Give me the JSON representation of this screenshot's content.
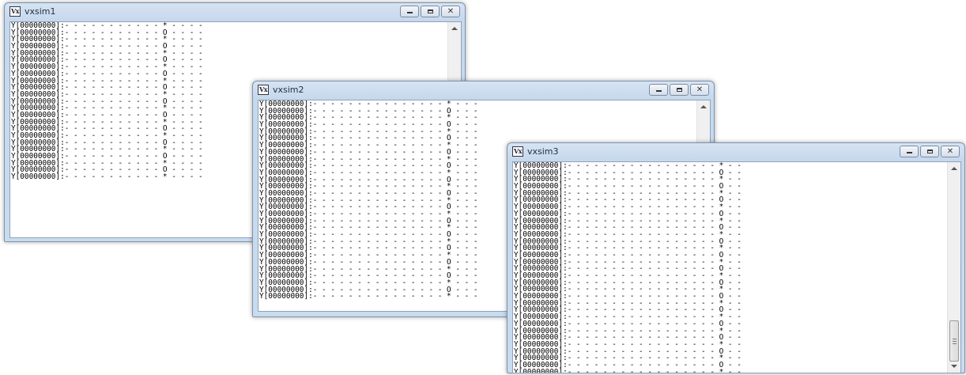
{
  "windows": [
    {
      "title": "vxsim1",
      "icon_label": "Vx",
      "lines": [
        "Y[00000000]:- - - - - - - - - - - * - - - -",
        "Y[00000000]:- - - - - - - - - - - O - - - -",
        "Y[00000000]:- - - - - - - - - - - * - - - -",
        "Y[00000000]:- - - - - - - - - - - O - - - -",
        "Y[00000000]:- - - - - - - - - - - * - - - -",
        "Y[00000000]:- - - - - - - - - - - O - - - -",
        "Y[00000000]:- - - - - - - - - - - * - - - -",
        "Y[00000000]:- - - - - - - - - - - O - - - -",
        "Y[00000000]:- - - - - - - - - - - * - - - -",
        "Y[00000000]:- - - - - - - - - - - O - - - -",
        "Y[00000000]:- - - - - - - - - - - * - - - -",
        "Y[00000000]:- - - - - - - - - - - O - - - -",
        "Y[00000000]:- - - - - - - - - - - * - - - -",
        "Y[00000000]:- - - - - - - - - - - O - - - -",
        "Y[00000000]:- - - - - - - - - - - * - - - -",
        "Y[00000000]:- - - - - - - - - - - O - - - -",
        "Y[00000000]:- - - - - - - - - - - * - - - -",
        "Y[00000000]:- - - - - - - - - - - O - - - -",
        "Y[00000000]:- - - - - - - - - - - * - - - -",
        "Y[00000000]:- - - - - - - - - - - O - - - -",
        "Y[00000000]:- - - - - - - - - - - * - - - -",
        "Y[00000000]:- - - - - - - - - - - O - - - -",
        "Y[00000000]:- - - - - - - - - - - * - - - -"
      ]
    },
    {
      "title": "vxsim2",
      "icon_label": "Vx",
      "lines": [
        "Y[00000000]:- - - - - - - - - - - - - - - * - - -",
        "Y[00000000]:- - - - - - - - - - - - - - - O - - -",
        "Y[00000000]:- - - - - - - - - - - - - - - * - - -",
        "Y[00000000]:- - - - - - - - - - - - - - - O - - -",
        "Y[00000000]:- - - - - - - - - - - - - - - * - - -",
        "Y[00000000]:- - - - - - - - - - - - - - - O - - -",
        "Y[00000000]:- - - - - - - - - - - - - - - * - - -",
        "Y[00000000]:- - - - - - - - - - - - - - - O - - -",
        "Y[00000000]:- - - - - - - - - - - - - - - * - - -",
        "Y[00000000]:- - - - - - - - - - - - - - - O - - -",
        "Y[00000000]:- - - - - - - - - - - - - - - * - - -",
        "Y[00000000]:- - - - - - - - - - - - - - - O - - -",
        "Y[00000000]:- - - - - - - - - - - - - - - * - - -",
        "Y[00000000]:- - - - - - - - - - - - - - - O - - -",
        "Y[00000000]:- - - - - - - - - - - - - - - * - - -",
        "Y[00000000]:- - - - - - - - - - - - - - - O - - -",
        "Y[00000000]:- - - - - - - - - - - - - - - * - - -",
        "Y[00000000]:- - - - - - - - - - - - - - - O - - -",
        "Y[00000000]:- - - - - - - - - - - - - - - * - - -",
        "Y[00000000]:- - - - - - - - - - - - - - - O - - -",
        "Y[00000000]:- - - - - - - - - - - - - - - * - - -",
        "Y[00000000]:- - - - - - - - - - - - - - - O - - -",
        "Y[00000000]:- - - - - - - - - - - - - - - * - - -",
        "Y[00000000]:- - - - - - - - - - - - - - - O - - -",
        "Y[00000000]:- - - - - - - - - - - - - - - * - - -",
        "Y[00000000]:- - - - - - - - - - - - - - - O - - -",
        "Y[00000000]:- - - - - - - - - - - - - - - * - - -",
        "Y[00000000]:- - - - - - - - - - - - - - - O - - -",
        "Y[00000000]:- - - - - - - - - - - - - - - * - - -"
      ]
    },
    {
      "title": "vxsim3",
      "icon_label": "Vx",
      "lines": [
        "Y[00000000]:- - - - - - - - - - - - - - - - - * - -",
        "Y[00000000]:- - - - - - - - - - - - - - - - - O - -",
        "Y[00000000]:- - - - - - - - - - - - - - - - - * - -",
        "Y[00000000]:- - - - - - - - - - - - - - - - - O - -",
        "Y[00000000]:- - - - - - - - - - - - - - - - - * - -",
        "Y[00000000]:- - - - - - - - - - - - - - - - - O - -",
        "Y[00000000]:- - - - - - - - - - - - - - - - - * - -",
        "Y[00000000]:- - - - - - - - - - - - - - - - - O - -",
        "Y[00000000]:- - - - - - - - - - - - - - - - - * - -",
        "Y[00000000]:- - - - - - - - - - - - - - - - - O - -",
        "Y[00000000]:- - - - - - - - - - - - - - - - - * - -",
        "Y[00000000]:- - - - - - - - - - - - - - - - - O - -",
        "Y[00000000]:- - - - - - - - - - - - - - - - - * - -",
        "Y[00000000]:- - - - - - - - - - - - - - - - - O - -",
        "Y[00000000]:- - - - - - - - - - - - - - - - - * - -",
        "Y[00000000]:- - - - - - - - - - - - - - - - - O - -",
        "Y[00000000]:- - - - - - - - - - - - - - - - - * - -",
        "Y[00000000]:- - - - - - - - - - - - - - - - - O - -",
        "Y[00000000]:- - - - - - - - - - - - - - - - - * - -",
        "Y[00000000]:- - - - - - - - - - - - - - - - - O - -",
        "Y[00000000]:- - - - - - - - - - - - - - - - - * - -",
        "Y[00000000]:- - - - - - - - - - - - - - - - - O - -",
        "Y[00000000]:- - - - - - - - - - - - - - - - - * - -",
        "Y[00000000]:- - - - - - - - - - - - - - - - - O - -",
        "Y[00000000]:- - - - - - - - - - - - - - - - - * - -",
        "Y[00000000]:- - - - - - - - - - - - - - - - - O - -",
        "Y[00000000]:- - - - - - - - - - - - - - - - - * - -",
        "Y[00000000]:- - - - - - - - - - - - - - - - - O - -",
        "Y[00000000]:- - - - - - - - - - - - - - - - - * - -",
        "Y[00000000]:- - - - - - - - - - - - - - - - - O - -",
        "Y[00000000]:- - - - - - - - - - - - - - - - - * - -"
      ]
    }
  ],
  "icons": {
    "app": "vx-app-icon",
    "minimize": "minimize-icon",
    "maximize": "maximize-icon",
    "close": "close-icon",
    "scroll_up": "scroll-up-arrow-icon",
    "scroll_down": "scroll-down-arrow-icon"
  },
  "colors": {
    "frame": "#c9dbee",
    "title_text": "#1e2f45",
    "console_bg": "#ffffff",
    "console_text": "#000000"
  },
  "close_glyph": "✕"
}
